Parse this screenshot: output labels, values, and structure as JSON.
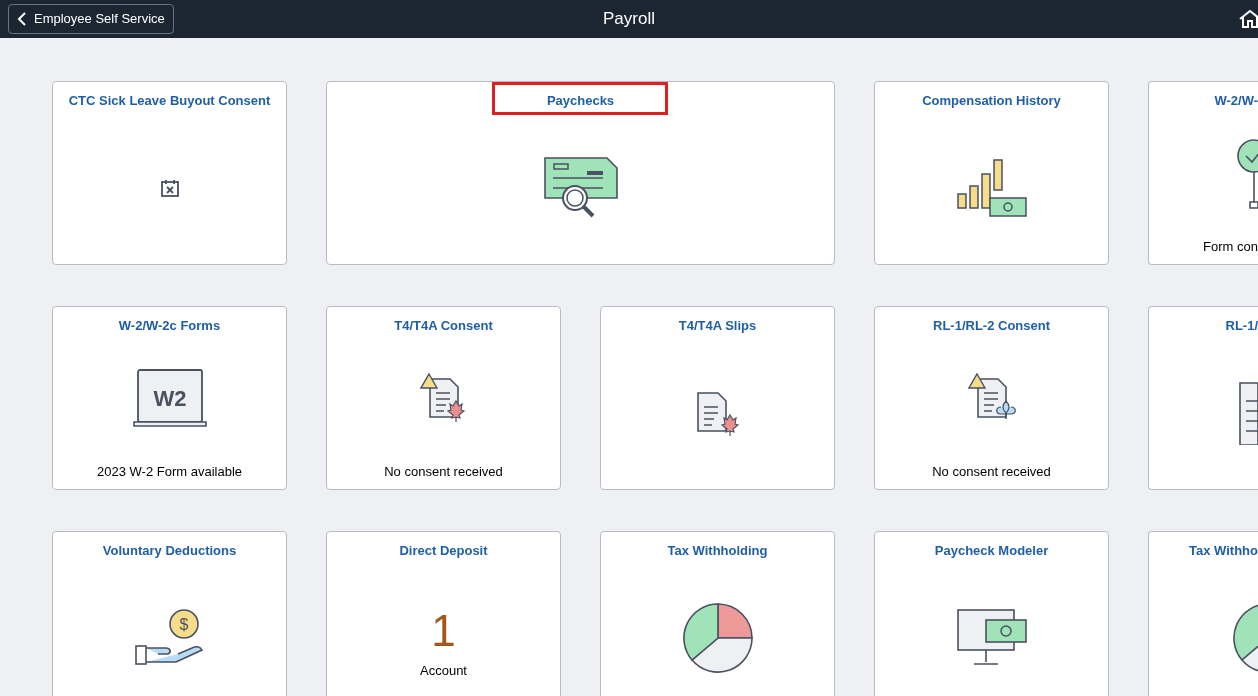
{
  "header": {
    "back_button": "Employee Self Service",
    "title": "Payroll"
  },
  "tiles": [
    {
      "kind": "icon",
      "title": "CTC Sick Leave Buyout Consent",
      "highlighted": false
    },
    {
      "kind": "icon",
      "title": "Paychecks",
      "highlighted": true
    },
    {
      "kind": "icon",
      "title": "Compensation History",
      "highlighted": false
    },
    {
      "kind": "icon",
      "title": "W-2/W-",
      "footer": "Form con",
      "highlighted": false
    },
    {
      "kind": "icon",
      "title": "W-2/W-2c Forms",
      "icon_text": "W2",
      "footer": "2023 W-2 Form available",
      "highlighted": false
    },
    {
      "kind": "icon",
      "title": "T4/T4A Consent",
      "footer": "No consent received",
      "highlighted": false
    },
    {
      "kind": "icon",
      "title": "T4/T4A Slips",
      "highlighted": false
    },
    {
      "kind": "icon",
      "title": "RL-1/RL-2 Consent",
      "footer": "No consent received",
      "highlighted": false
    },
    {
      "kind": "icon",
      "title": "RL-1/",
      "highlighted": false
    },
    {
      "kind": "icon",
      "title": "Voluntary Deductions",
      "icon_text": "$",
      "highlighted": false
    },
    {
      "kind": "count",
      "title": "Direct Deposit",
      "count": "1",
      "footer": "Account",
      "highlighted": false
    },
    {
      "kind": "icon",
      "title": "Tax Withholding",
      "highlighted": false
    },
    {
      "kind": "icon",
      "title": "Paycheck Modeler",
      "highlighted": false
    },
    {
      "kind": "icon",
      "title": "Tax Withho",
      "highlighted": false
    }
  ]
}
